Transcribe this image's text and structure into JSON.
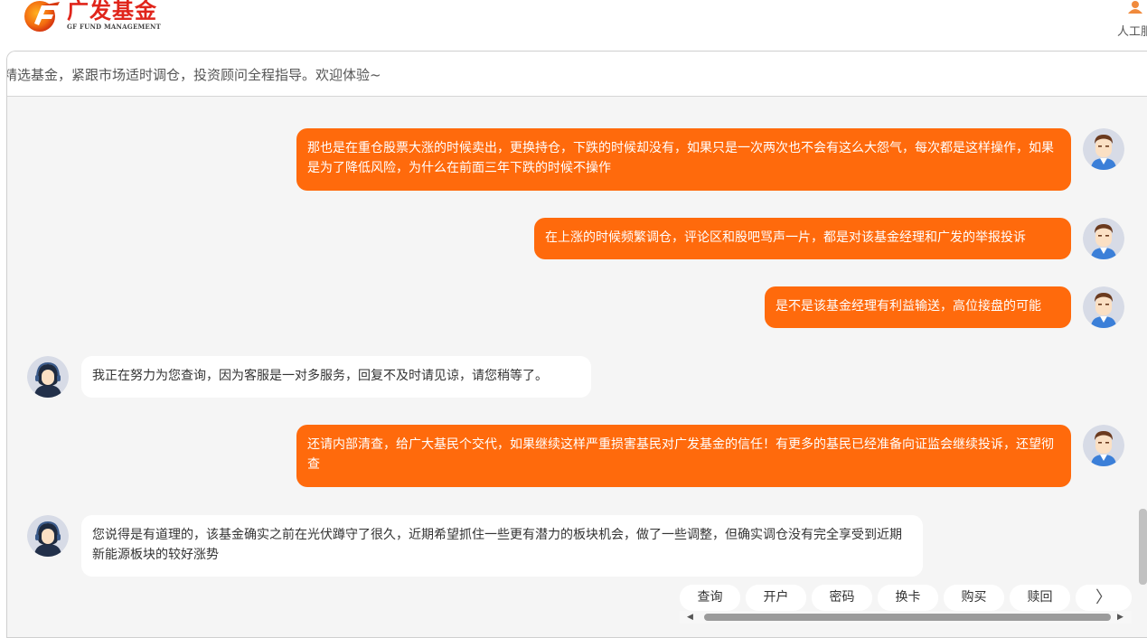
{
  "header": {
    "logo_cn": "广发基金",
    "logo_en": "GF FUND MANAGEMENT",
    "service_label": "人工服"
  },
  "notice": {
    "text": "精选基金，紧跟市场适时调仓，投资顾问全程指导。欢迎体验~"
  },
  "messages": [
    {
      "role": "user",
      "text": "那也是在重仓股票大涨的时候卖出，更换持仓，下跌的时候却没有，如果只是一次两次也不会有这么大怨气，每次都是这样操作，如果是为了降低风险，为什么在前面三年下跌的时候不操作"
    },
    {
      "role": "user",
      "text": "在上涨的时候频繁调仓，评论区和股吧骂声一片，都是对该基金经理和广发的举报投诉"
    },
    {
      "role": "user",
      "text": "是不是该基金经理有利益输送，高位接盘的可能"
    },
    {
      "role": "agent",
      "text": "我正在努力为您查询，因为客服是一对多服务，回复不及时请见谅，请您稍等了。"
    },
    {
      "role": "user",
      "text": "还请内部清查，给广大基民个交代，如果继续这样严重损害基民对广发基金的信任！有更多的基民已经准备向证监会继续投诉，还望彻查"
    },
    {
      "role": "agent",
      "text": "您说得是有道理的，该基金确实之前在光伏蹲守了很久，近期希望抓住一些更有潜力的板块机会，做了一些调整，但确实调仓没有完全享受到近期新能源板块的较好涨势"
    }
  ],
  "quick_actions": [
    "查询",
    "开户",
    "密码",
    "换卡",
    "购买",
    "赎回"
  ],
  "quick_next": "〉",
  "colors": {
    "accent": "#ff6a0c",
    "brand": "#e0251b",
    "panel_bg": "#f5f5f5"
  },
  "icons": {
    "user_avatar": "user-avatar-icon",
    "agent_avatar": "agent-avatar-icon",
    "service": "customer-service-icon"
  }
}
